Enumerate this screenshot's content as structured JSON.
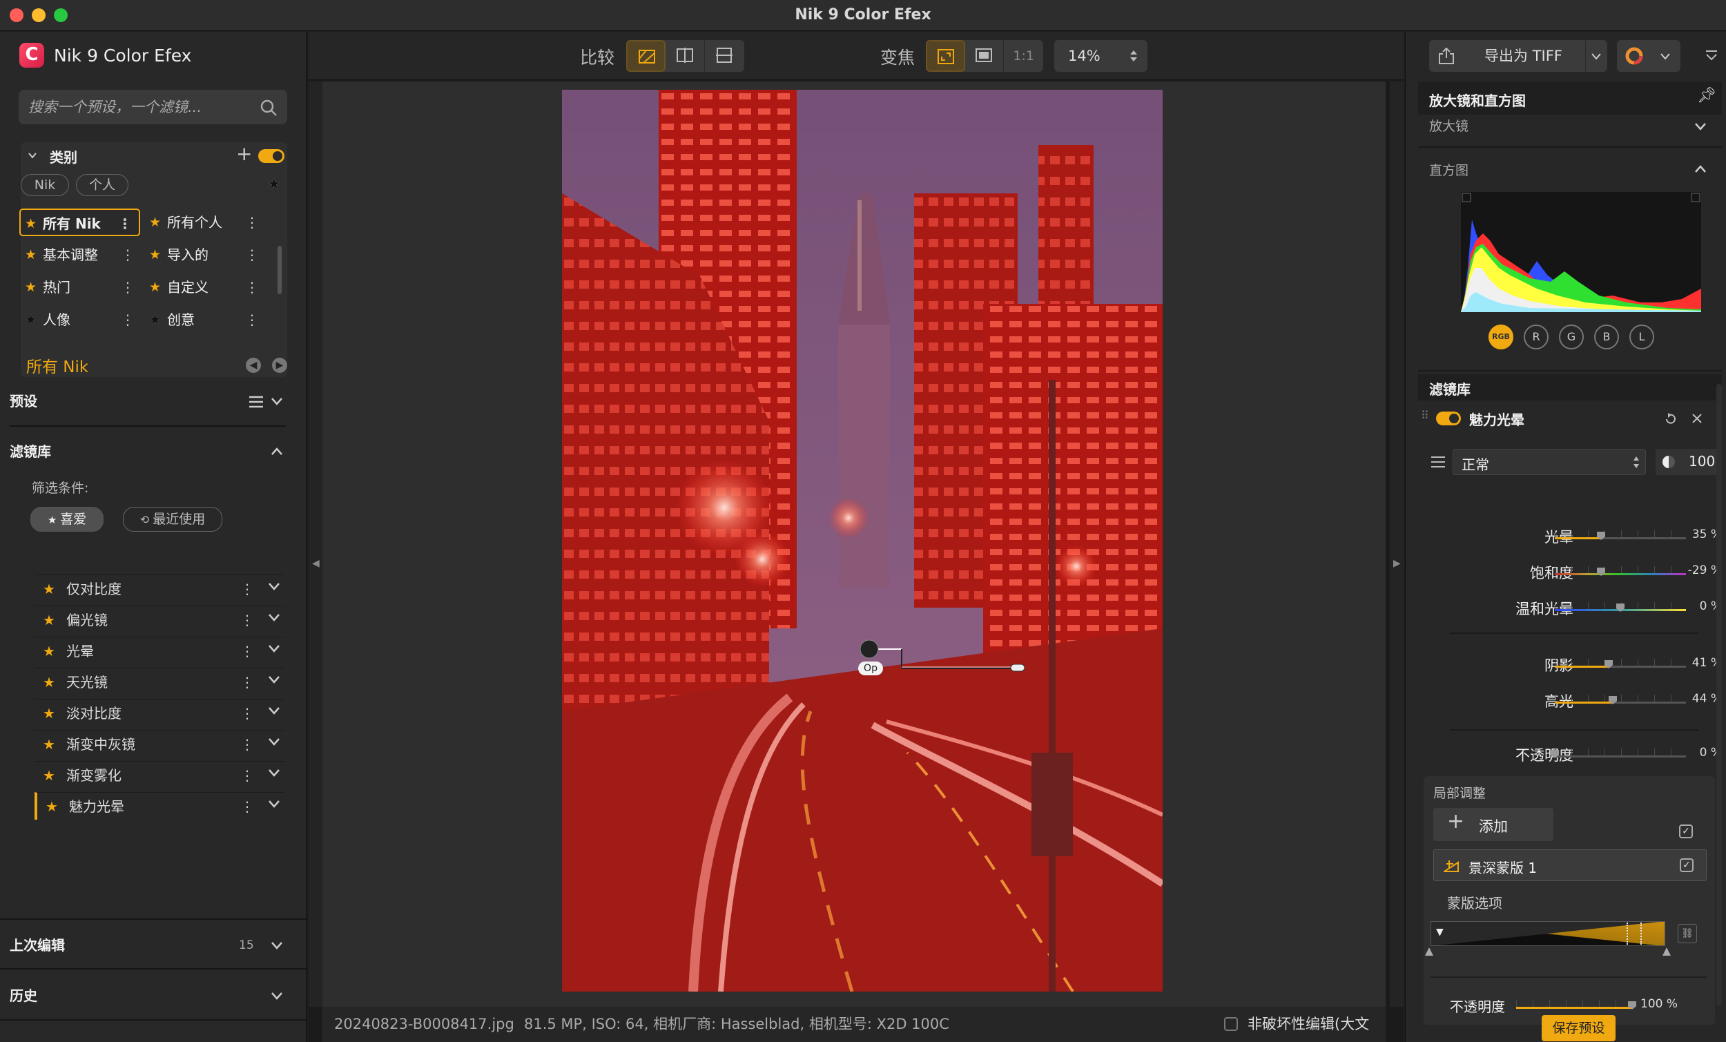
{
  "window": {
    "title": "Nik 9 Color Efex"
  },
  "sidebar": {
    "app_name": "Nik 9 Color Efex",
    "search": {
      "placeholder": "搜索一个预设，一个滤镜..."
    },
    "categories": {
      "heading": "类别",
      "toggle_on": true,
      "pills": [
        "Nik",
        "个人"
      ],
      "items": [
        {
          "label": "所有 Nik",
          "starred": true,
          "selected": true
        },
        {
          "label": "所有个人",
          "starred": true
        },
        {
          "label": "基本调整",
          "starred": true
        },
        {
          "label": "导入的",
          "starred": true
        },
        {
          "label": "热门",
          "starred": true
        },
        {
          "label": "自定义",
          "starred": true
        },
        {
          "label": "人像",
          "starred": false
        },
        {
          "label": "创意",
          "starred": false
        }
      ]
    },
    "current_category": "所有 Nik",
    "presets_heading": "预设",
    "filter_library": {
      "heading": "滤镜库",
      "filter_label": "筛选条件:",
      "favorites_label": "喜爱",
      "recent_label": "最近使用",
      "filters": [
        "仅对比度",
        "偏光镜",
        "光晕",
        "天光镜",
        "淡对比度",
        "渐变中灰镜",
        "渐变雾化",
        "魅力光晕"
      ],
      "active_filter": "魅力光晕"
    },
    "last_edit": {
      "heading": "上次编辑",
      "count": "15"
    },
    "history_heading": "历史"
  },
  "toolbar": {
    "compare_label": "比较",
    "zoom_label": "变焦",
    "one_to_one": "1:1",
    "zoom_value": "14%"
  },
  "image": {
    "control_point_label": "Op"
  },
  "status": {
    "filename": "20240823-B0008417.jpg",
    "meta": "81.5 MP, ISO: 64, 相机厂商: Hasselblad, 相机型号: X2D 100C",
    "nondestructive_label": "非破坏性编辑(大文件)"
  },
  "right_panel": {
    "export_label": "导出为 TIFF",
    "loupe_hist_heading": "放大镜和直方图",
    "loupe_label": "放大镜",
    "histogram_label": "直方图",
    "channels": [
      "RGB",
      "R",
      "G",
      "B",
      "L"
    ],
    "filter_stack_heading": "滤镜库",
    "filter": {
      "name": "魅力光晕",
      "enabled": true,
      "blend_mode": "正常",
      "opacity_value": "100",
      "sliders": [
        {
          "label": "光晕",
          "value": "35 %",
          "level": 0.35
        },
        {
          "label": "饱和度",
          "value": "-29 %",
          "level": 0.35
        },
        {
          "label": "温和光晕",
          "value": "0 %",
          "level": 0.5
        },
        {
          "label": "阴影",
          "value": "41 %",
          "level": 0.41
        },
        {
          "label": "高光",
          "value": "44 %",
          "level": 0.44
        },
        {
          "label": "不透明度",
          "value": "0 %",
          "level": 0.0
        }
      ]
    },
    "local_adjust": {
      "heading": "局部调整",
      "add_label": "添加",
      "mask_item": "景深蒙版 1",
      "mask_options_label": "蒙版选项",
      "opacity_label": "不透明度",
      "opacity_value": "100 %"
    },
    "save_preset_label": "保存预设"
  },
  "colors": {
    "accent": "#f0a911",
    "panel": "#282828",
    "canvas": "#2e2e2e",
    "image_tint": "#c8201c"
  }
}
